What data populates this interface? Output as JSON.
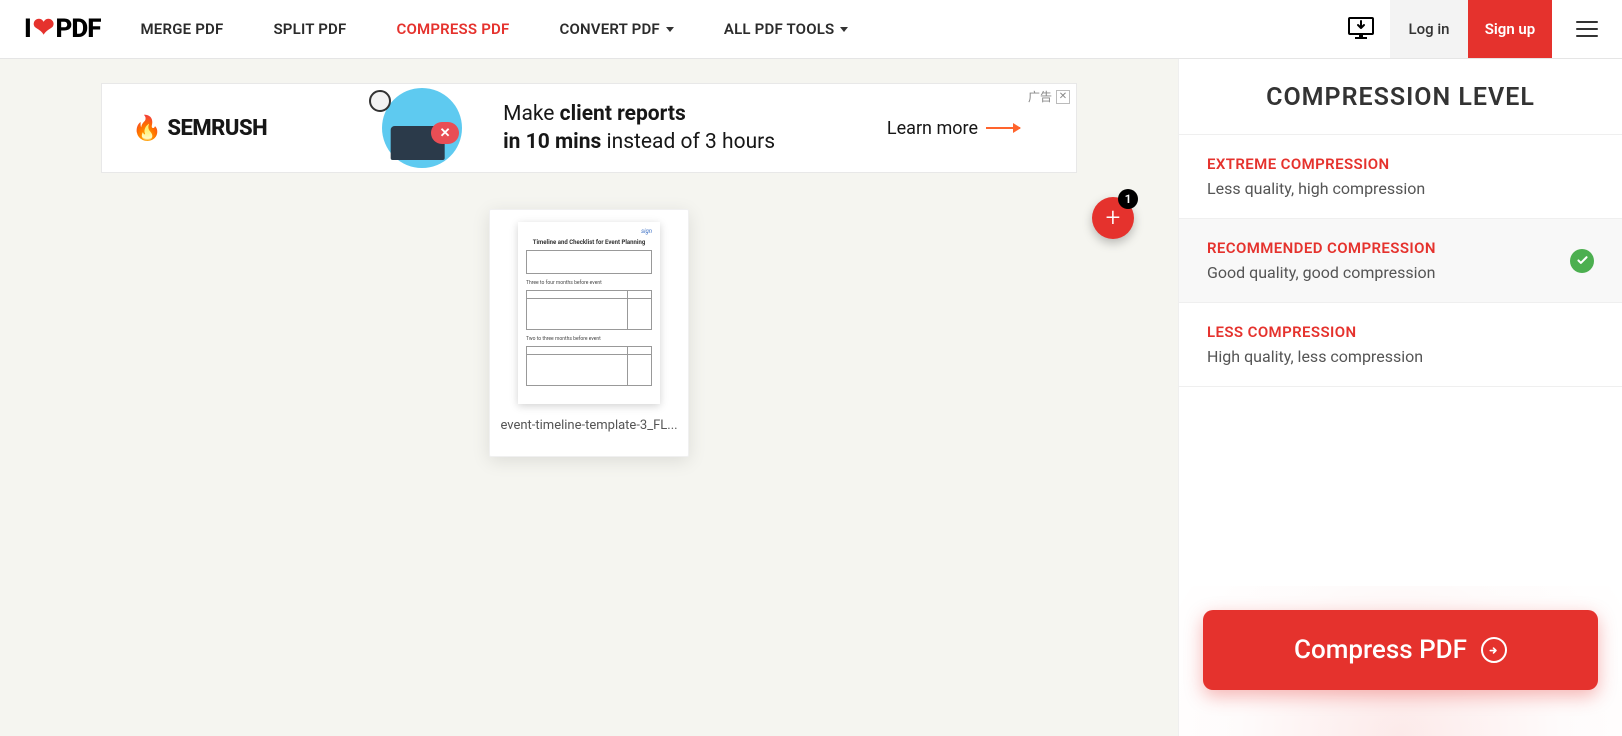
{
  "logo": {
    "pre": "I",
    "post": "PDF"
  },
  "nav": {
    "merge": "MERGE PDF",
    "split": "SPLIT PDF",
    "compress": "COMPRESS PDF",
    "convert": "CONVERT PDF",
    "all": "ALL PDF TOOLS"
  },
  "header": {
    "login": "Log in",
    "signup": "Sign up"
  },
  "ad": {
    "brand": "SEMRUSH",
    "line1_a": "Make ",
    "line1_b": "client reports",
    "line2_a": "in 10 mins ",
    "line2_b": "instead of 3 hours",
    "cta": "Learn more",
    "label": "广告",
    "badge": "✕"
  },
  "file": {
    "name": "event-timeline-template-3_FL...",
    "count": "1",
    "thumb_title": "Timeline and Checklist for Event Planning",
    "thumb_sig": "sign"
  },
  "sidebar": {
    "title": "COMPRESSION LEVEL",
    "options": [
      {
        "title": "EXTREME COMPRESSION",
        "desc": "Less quality, high compression"
      },
      {
        "title": "RECOMMENDED COMPRESSION",
        "desc": "Good quality, good compression"
      },
      {
        "title": "LESS COMPRESSION",
        "desc": "High quality, less compression"
      }
    ],
    "cta": "Compress PDF"
  }
}
